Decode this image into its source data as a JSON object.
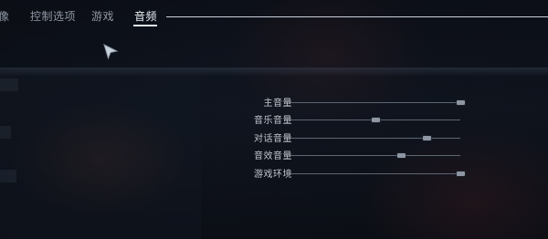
{
  "tabs": [
    {
      "label": "像",
      "active": false
    },
    {
      "label": "控制选项",
      "active": false
    },
    {
      "label": "游戏",
      "active": false
    },
    {
      "label": "音频",
      "active": true
    }
  ],
  "audio_settings": [
    {
      "label": "主音量",
      "value": 1.0
    },
    {
      "label": "音乐音量",
      "value": 0.5
    },
    {
      "label": "对话音量",
      "value": 0.8
    },
    {
      "label": "音效音量",
      "value": 0.65
    },
    {
      "label": "游戏环境",
      "value": 1.0
    }
  ],
  "colors": {
    "accent_text": "#e9eef4",
    "inactive_text": "#8f97a3",
    "slider_track": "#5d6673",
    "slider_handle": "#8d96a2"
  }
}
